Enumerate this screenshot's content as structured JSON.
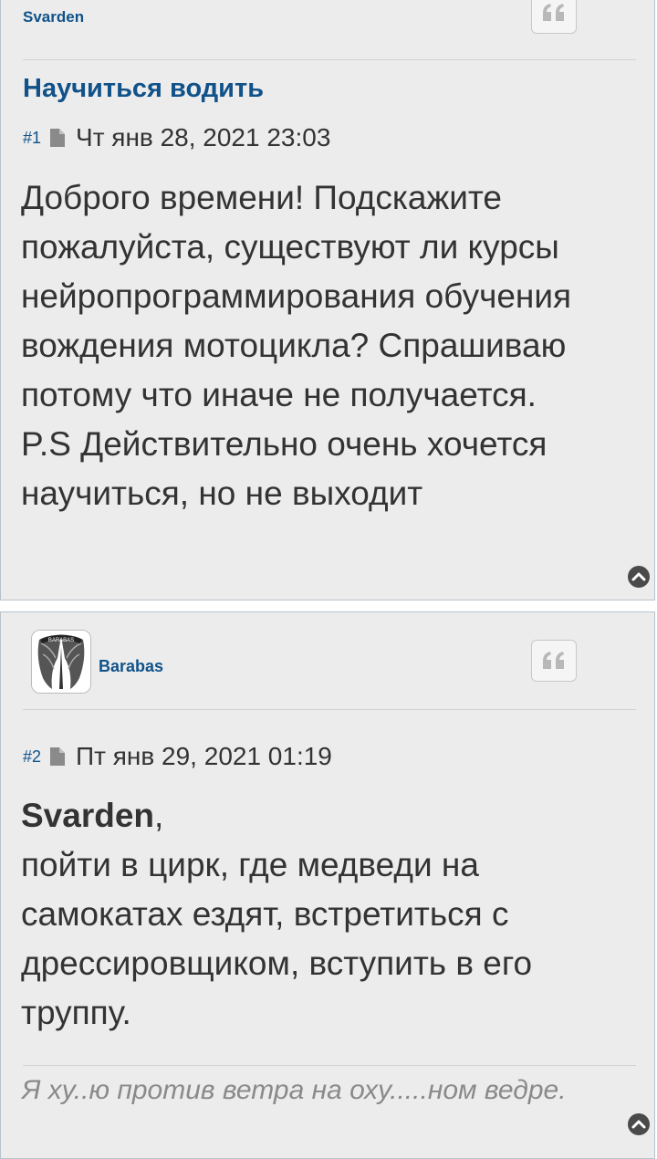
{
  "post1": {
    "author": "Svarden",
    "title": "Научиться водить",
    "number": "#1",
    "date": "Чт янв 28, 2021 23:03",
    "content": "Доброго времени! Подскажите пожалуйста, существуют ли курсы нейропрограммирования обучения вождения мотоцикла? Спрашиваю потому что иначе не получается.\nP.S Действительно очень хочется научиться, но не выходит"
  },
  "post2": {
    "author": "Barabas",
    "avatar_text": "BARABAS",
    "number": "#2",
    "date": "Пт янв 29, 2021 01:19",
    "addressee": "Svarden",
    "comma": ",",
    "content": "пойти в цирк, где медведи на самокатах ездят, встретиться с дрессировщиком, вступить в его труппу.",
    "signature": "Я ху..ю против ветра на оху.....ном ведре."
  },
  "icons": {
    "quote": "quote-icon",
    "post_link": "document-icon",
    "back_to_top": "chevron-up-circle-icon"
  },
  "colors": {
    "link": "#105289",
    "post_bg": "#ececec",
    "text": "#333333",
    "signature": "#8a8a8a"
  }
}
